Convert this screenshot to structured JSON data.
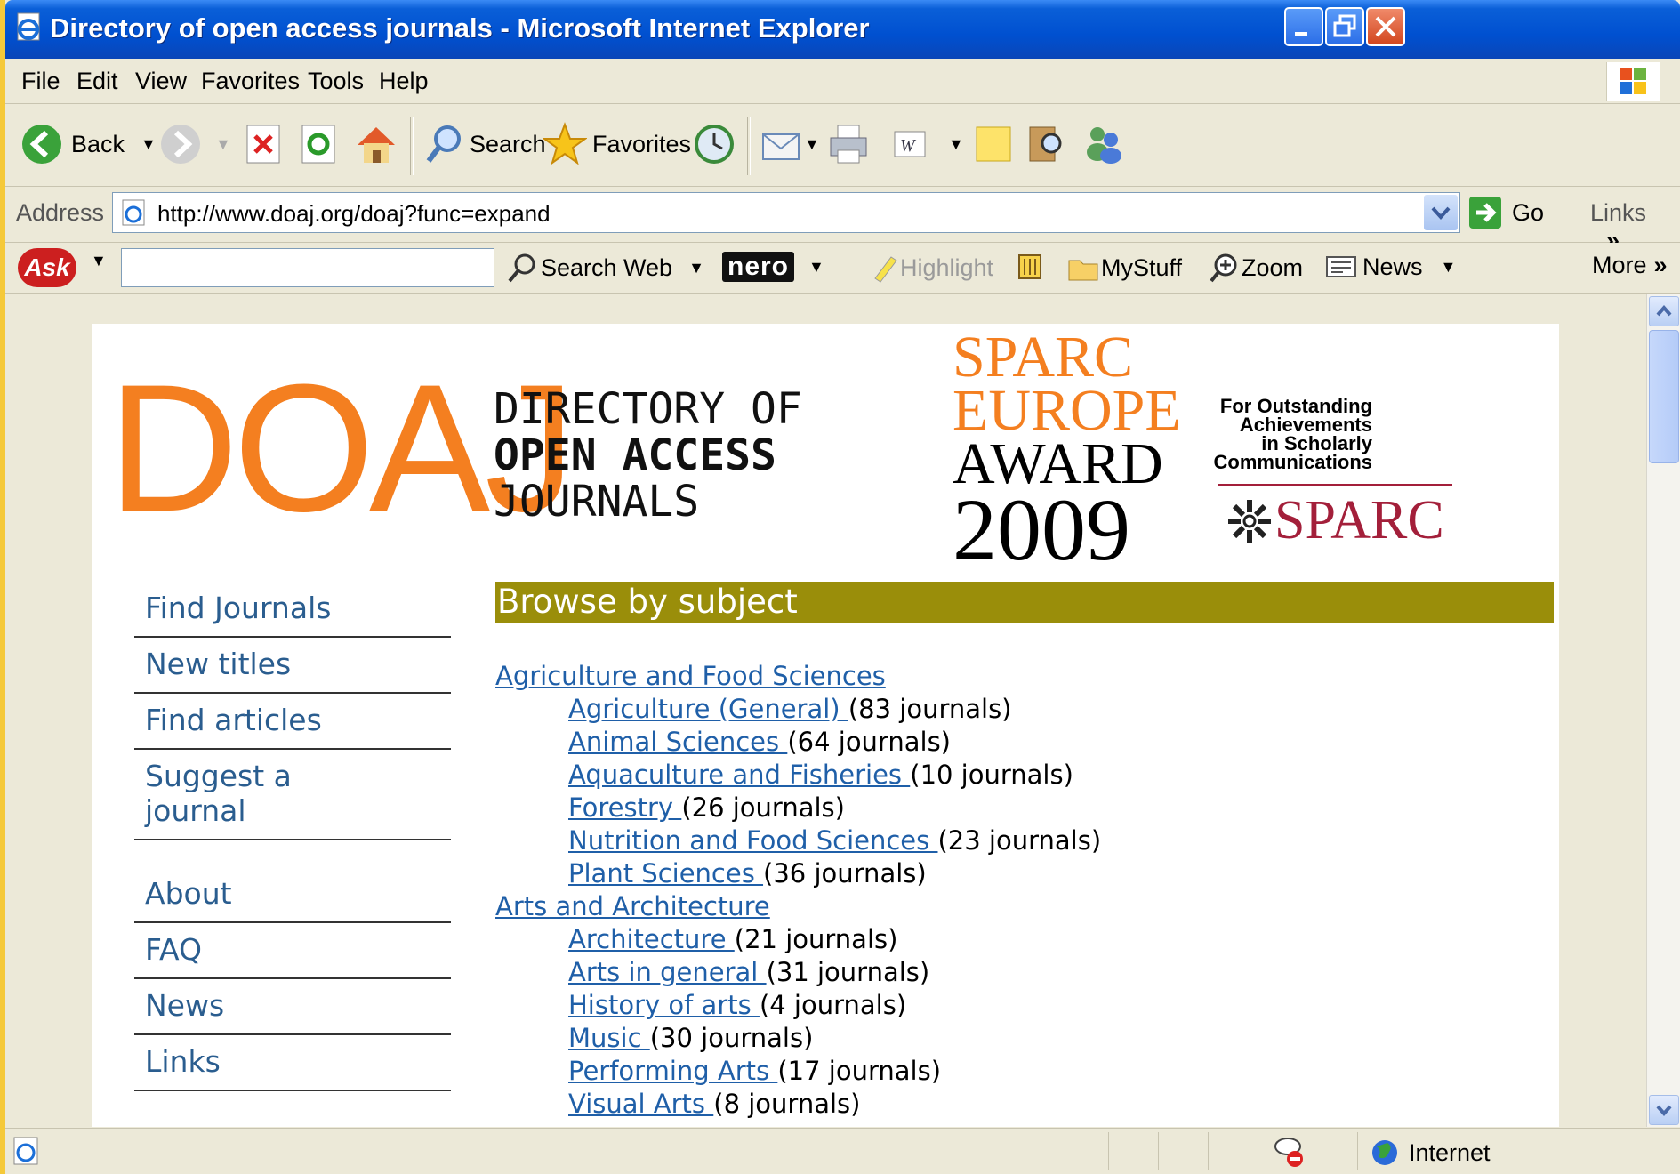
{
  "window": {
    "title": "Directory of open access journals - Microsoft Internet Explorer"
  },
  "menubar": [
    "File",
    "Edit",
    "View",
    "Favorites",
    "Tools",
    "Help"
  ],
  "toolbar": {
    "back": "Back",
    "search": "Search",
    "favorites": "Favorites"
  },
  "addressbar": {
    "label": "Address",
    "url": "http://www.doaj.org/doaj?func=expand",
    "go": "Go",
    "links": "Links"
  },
  "askbar": {
    "search_web": "Search Web",
    "nero": "nero",
    "highlight": "Highlight",
    "mystuff": "MyStuff",
    "zoom": "Zoom",
    "news": "News",
    "more": "More"
  },
  "header": {
    "logo": "DOAJ",
    "subtitle": [
      "DIRECTORY OF",
      "OPEN ACCESS",
      "JOURNALS"
    ],
    "award": [
      "SPARC",
      "EUROPE",
      "AWARD",
      "2009"
    ],
    "award_caption": [
      "For Outstanding",
      "Achievements",
      "in Scholarly",
      "Communications"
    ],
    "sparc_logo": "SPARC"
  },
  "sidebar": {
    "items": [
      "Find Journals",
      "New titles",
      "Find articles",
      "Suggest a journal"
    ],
    "items2": [
      "About",
      "FAQ",
      "News",
      "Links"
    ]
  },
  "main": {
    "heading": "Browse by subject",
    "categories": [
      {
        "name": "Agriculture and Food Sciences",
        "subs": [
          {
            "name": "Agriculture (General) ",
            "count": "(83 journals)"
          },
          {
            "name": "Animal Sciences ",
            "count": "(64 journals)"
          },
          {
            "name": "Aquaculture and Fisheries ",
            "count": "(10 journals)"
          },
          {
            "name": "Forestry ",
            "count": "(26 journals)"
          },
          {
            "name": "Nutrition and Food Sciences ",
            "count": "(23 journals)"
          },
          {
            "name": "Plant Sciences ",
            "count": "(36 journals)"
          }
        ]
      },
      {
        "name": "Arts and Architecture",
        "subs": [
          {
            "name": "Architecture ",
            "count": "(21 journals)"
          },
          {
            "name": "Arts in general ",
            "count": "(31 journals)"
          },
          {
            "name": "History of arts ",
            "count": "(4 journals)"
          },
          {
            "name": "Music ",
            "count": "(30 journals)"
          },
          {
            "name": "Performing Arts ",
            "count": "(17 journals)"
          },
          {
            "name": "Visual Arts ",
            "count": "(8 journals)"
          }
        ]
      }
    ]
  },
  "statusbar": {
    "zone": "Internet"
  }
}
